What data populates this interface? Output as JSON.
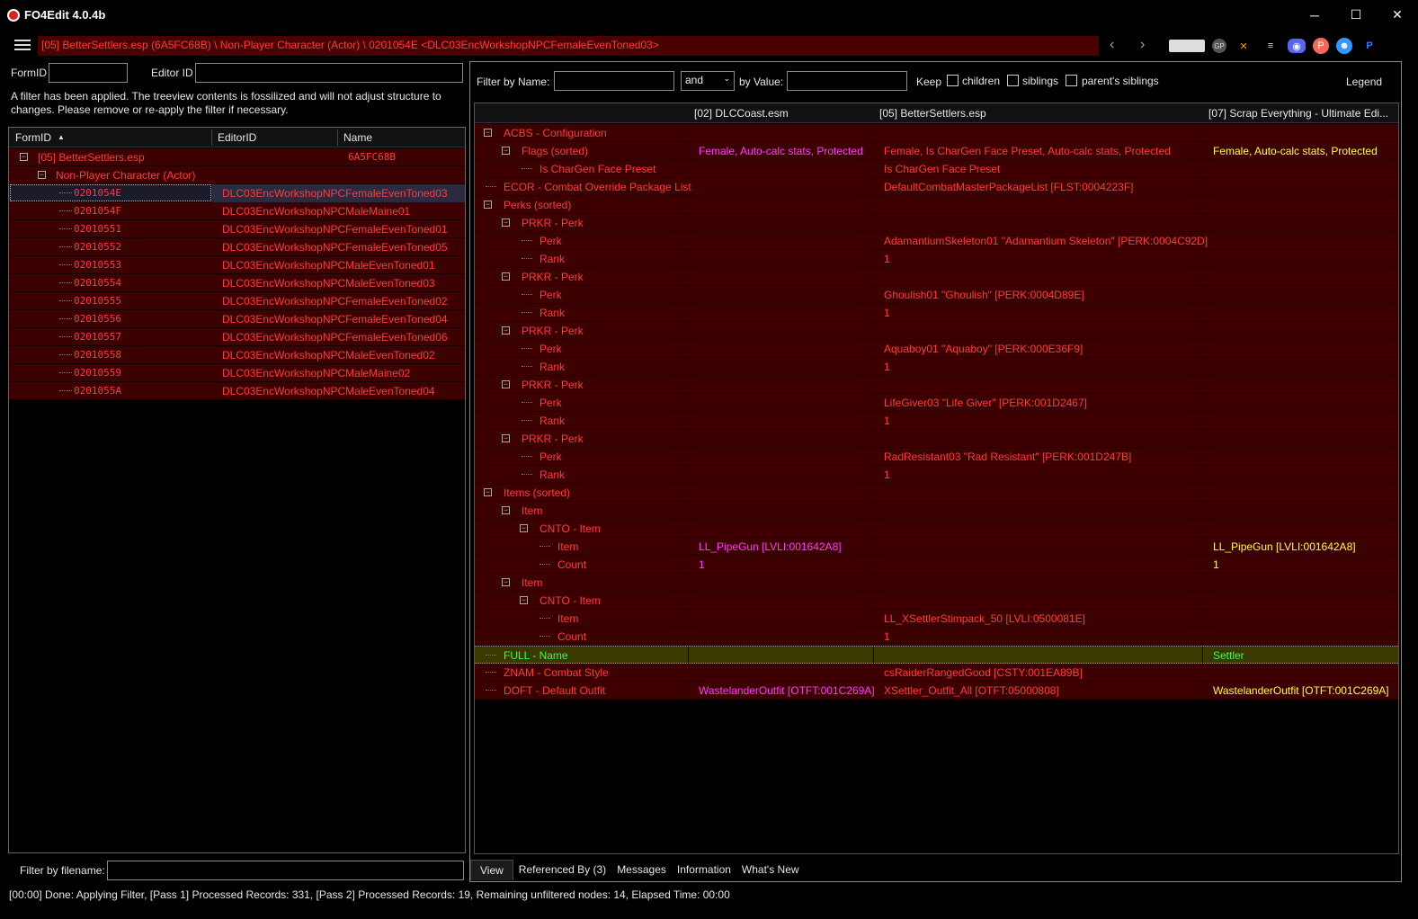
{
  "window": {
    "title": "FO4Edit 4.0.4b",
    "minimize": "─",
    "maximize": "☐",
    "close": "✕"
  },
  "nav": {
    "breadcrumb": "[05] BetterSettlers.esp (6A5FC68B) \\ Non-Player Character (Actor) \\ 0201054E <DLC03EncWorkshopNPCFemaleEvenToned03>",
    "back": "‹",
    "forward": "›",
    "icons": [
      "book-icon",
      "gp-icon",
      "x-icon",
      "bethesda-icon",
      "discord-icon",
      "patreon-icon",
      "reddit-icon",
      "paypal-icon"
    ]
  },
  "left": {
    "formid_label": "FormID",
    "editorid_label": "Editor ID",
    "formid_value": "",
    "editorid_value": "",
    "filter_message": "A filter has been applied. The treeview contents is fossilized and will not adjust structure to changes.  Please remove or re-apply the filter if necessary.",
    "columns": [
      "FormID",
      "EditorID",
      "Name"
    ],
    "file_node": {
      "label": "[05] BetterSettlers.esp",
      "name": "6A5FC68B"
    },
    "group_node": {
      "label": "Non-Player Character (Actor)"
    },
    "records": [
      {
        "formid": "0201054E",
        "editorid": "DLC03EncWorkshopNPCFemaleEvenToned03"
      },
      {
        "formid": "0201054F",
        "editorid": "DLC03EncWorkshopNPCMaleMaine01"
      },
      {
        "formid": "02010551",
        "editorid": "DLC03EncWorkshopNPCFemaleEvenToned01"
      },
      {
        "formid": "02010552",
        "editorid": "DLC03EncWorkshopNPCFemaleEvenToned05"
      },
      {
        "formid": "02010553",
        "editorid": "DLC03EncWorkshopNPCMaleEvenToned01"
      },
      {
        "formid": "02010554",
        "editorid": "DLC03EncWorkshopNPCMaleEvenToned03"
      },
      {
        "formid": "02010555",
        "editorid": "DLC03EncWorkshopNPCFemaleEvenToned02"
      },
      {
        "formid": "02010556",
        "editorid": "DLC03EncWorkshopNPCFemaleEvenToned04"
      },
      {
        "formid": "02010557",
        "editorid": "DLC03EncWorkshopNPCFemaleEvenToned06"
      },
      {
        "formid": "02010558",
        "editorid": "DLC03EncWorkshopNPCMaleEvenToned02"
      },
      {
        "formid": "02010559",
        "editorid": "DLC03EncWorkshopNPCMaleMaine02"
      },
      {
        "formid": "0201055A",
        "editorid": "DLC03EncWorkshopNPCMaleEvenToned04"
      }
    ],
    "filter_filename_label": "Filter by filename:"
  },
  "right": {
    "filter_name_label": "Filter by Name:",
    "and_select": "and",
    "by_value_label": "by Value:",
    "keep_label": "Keep",
    "children_label": "children",
    "siblings_label": "siblings",
    "parents_siblings_label": "parent's siblings",
    "legend_label": "Legend",
    "columns": [
      "[02] DLCCoast.esm",
      "[05] BetterSettlers.esp",
      "[07] Scrap Everything - Ultimate Edi..."
    ],
    "rows": [
      {
        "level": 0,
        "exp": "-",
        "label": "ACBS - Configuration",
        "a": "",
        "b": "",
        "c": ""
      },
      {
        "level": 1,
        "exp": "-",
        "label": "Flags (sorted)",
        "a": "Female, Auto-calc stats, Protected",
        "b": "Female, Is CharGen Face Preset, Auto-calc stats, Protected",
        "c": "Female, Auto-calc stats, Protected"
      },
      {
        "level": 2,
        "exp": "",
        "label": "Is CharGen Face Preset",
        "a": "",
        "b": "Is CharGen Face Preset",
        "c": ""
      },
      {
        "level": 0,
        "exp": "",
        "label": "ECOR - Combat Override Package List",
        "a": "",
        "b": "DefaultCombatMasterPackageList [FLST:0004223F]",
        "c": ""
      },
      {
        "level": 0,
        "exp": "-",
        "label": "Perks (sorted)",
        "a": "",
        "b": "",
        "c": ""
      },
      {
        "level": 1,
        "exp": "-",
        "label": "PRKR - Perk",
        "a": "",
        "b": "",
        "c": ""
      },
      {
        "level": 2,
        "exp": "",
        "label": "Perk",
        "a": "",
        "b": "AdamantiumSkeleton01 \"Adamantium Skeleton\" [PERK:0004C92D]",
        "c": ""
      },
      {
        "level": 2,
        "exp": "",
        "label": "Rank",
        "a": "",
        "b": "1",
        "c": ""
      },
      {
        "level": 1,
        "exp": "-",
        "label": "PRKR - Perk",
        "a": "",
        "b": "",
        "c": ""
      },
      {
        "level": 2,
        "exp": "",
        "label": "Perk",
        "a": "",
        "b": "Ghoulish01 \"Ghoulish\" [PERK:0004D89E]",
        "c": ""
      },
      {
        "level": 2,
        "exp": "",
        "label": "Rank",
        "a": "",
        "b": "1",
        "c": ""
      },
      {
        "level": 1,
        "exp": "-",
        "label": "PRKR - Perk",
        "a": "",
        "b": "",
        "c": ""
      },
      {
        "level": 2,
        "exp": "",
        "label": "Perk",
        "a": "",
        "b": "Aquaboy01 \"Aquaboy\" [PERK:000E36F9]",
        "c": ""
      },
      {
        "level": 2,
        "exp": "",
        "label": "Rank",
        "a": "",
        "b": "1",
        "c": ""
      },
      {
        "level": 1,
        "exp": "-",
        "label": "PRKR - Perk",
        "a": "",
        "b": "",
        "c": ""
      },
      {
        "level": 2,
        "exp": "",
        "label": "Perk",
        "a": "",
        "b": "LifeGiver03 \"Life Giver\" [PERK:001D2467]",
        "c": ""
      },
      {
        "level": 2,
        "exp": "",
        "label": "Rank",
        "a": "",
        "b": "1",
        "c": ""
      },
      {
        "level": 1,
        "exp": "-",
        "label": "PRKR - Perk",
        "a": "",
        "b": "",
        "c": ""
      },
      {
        "level": 2,
        "exp": "",
        "label": "Perk",
        "a": "",
        "b": "RadResistant03 \"Rad Resistant\" [PERK:001D247B]",
        "c": ""
      },
      {
        "level": 2,
        "exp": "",
        "label": "Rank",
        "a": "",
        "b": "1",
        "c": ""
      },
      {
        "level": 0,
        "exp": "-",
        "label": "Items (sorted)",
        "a": "",
        "b": "",
        "c": ""
      },
      {
        "level": 1,
        "exp": "-",
        "label": "Item",
        "a": "",
        "b": "",
        "c": ""
      },
      {
        "level": 2,
        "exp": "-",
        "label": "CNTO - Item",
        "a": "",
        "b": "",
        "c": ""
      },
      {
        "level": 3,
        "exp": "",
        "label": "Item",
        "a": "LL_PipeGun [LVLI:001642A8]",
        "b": "",
        "c": "LL_PipeGun [LVLI:001642A8]"
      },
      {
        "level": 3,
        "exp": "",
        "label": "Count",
        "a": "1",
        "b": "",
        "c": "1"
      },
      {
        "level": 1,
        "exp": "-",
        "label": "Item",
        "a": "",
        "b": "",
        "c": ""
      },
      {
        "level": 2,
        "exp": "-",
        "label": "CNTO - Item",
        "a": "",
        "b": "",
        "c": ""
      },
      {
        "level": 3,
        "exp": "",
        "label": "Item",
        "a": "",
        "b": "LL_XSettlerStimpack_50 [LVLI:0500081E]",
        "c": ""
      },
      {
        "level": 3,
        "exp": "",
        "label": "Count",
        "a": "",
        "b": "1",
        "c": ""
      },
      {
        "level": 0,
        "exp": "",
        "label": "FULL - Name",
        "a": "",
        "b": "",
        "c": "Settler",
        "style": "yellow"
      },
      {
        "level": 0,
        "exp": "",
        "label": "ZNAM - Combat Style",
        "a": "",
        "b": "csRaiderRangedGood [CSTY:001EA89B]",
        "c": ""
      },
      {
        "level": 0,
        "exp": "",
        "label": "DOFT - Default Outfit",
        "a": "WastelanderOutfit [OTFT:001C269A]",
        "b": "XSettler_Outfit_All [OTFT:05000808]",
        "c": "WastelanderOutfit [OTFT:001C269A]"
      }
    ],
    "tabs": [
      "View",
      "Referenced By (3)",
      "Messages",
      "Information",
      "What's New"
    ]
  },
  "status": "[00:00] Done: Applying Filter, [Pass 1] Processed Records: 331, [Pass 2] Processed Records: 19, Remaining unfiltered nodes: 14, Elapsed Time: 00:00",
  "colors": {
    "red": "#ff3b3b",
    "magenta": "#ff3bff",
    "yellow": "#ffff3b",
    "green": "#3bff3b",
    "rowbg": "#3c0000"
  }
}
